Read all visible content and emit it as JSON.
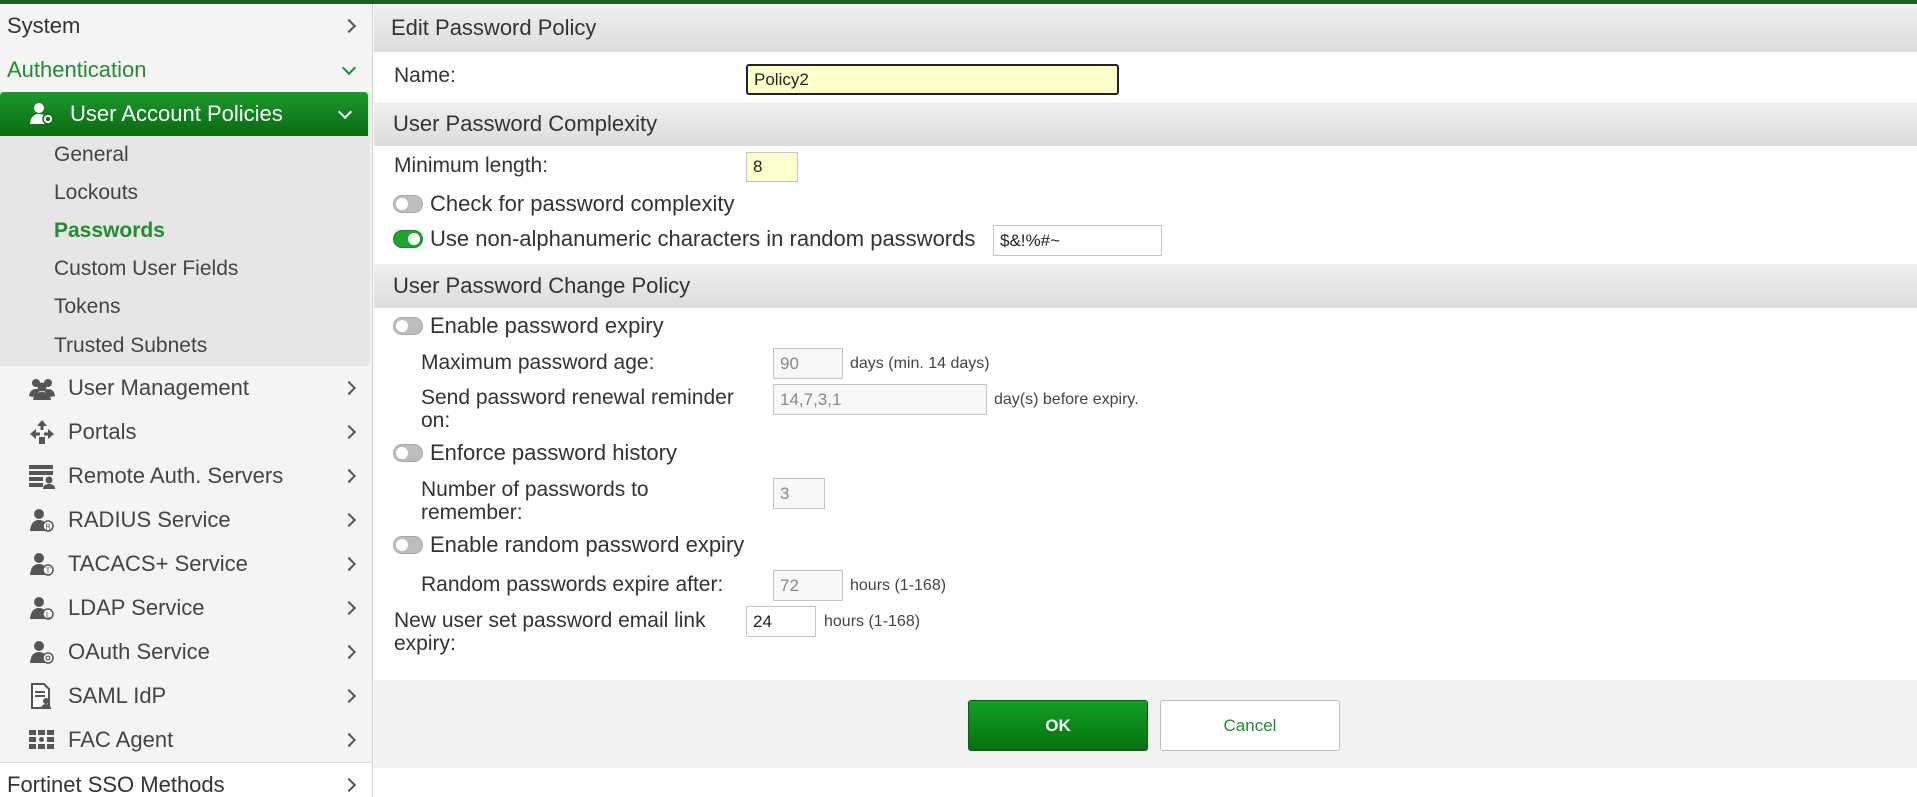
{
  "sidebar": {
    "system": "System",
    "authentication": "Authentication",
    "section": "User Account Policies",
    "sub_items": [
      "General",
      "Lockouts",
      "Passwords",
      "Custom User Fields",
      "Tokens",
      "Trusted Subnets"
    ],
    "selected_sub": "Passwords",
    "items": [
      {
        "label": "User Management",
        "icon": "users-icon"
      },
      {
        "label": "Portals",
        "icon": "portals-icon"
      },
      {
        "label": "Remote Auth. Servers",
        "icon": "servers-icon"
      },
      {
        "label": "RADIUS Service",
        "icon": "radius-icon"
      },
      {
        "label": "TACACS+ Service",
        "icon": "tacacs-icon"
      },
      {
        "label": "LDAP Service",
        "icon": "ldap-icon"
      },
      {
        "label": "OAuth Service",
        "icon": "oauth-icon"
      },
      {
        "label": "SAML IdP",
        "icon": "saml-icon"
      },
      {
        "label": "FAC Agent",
        "icon": "fac-agent-icon"
      }
    ],
    "fortinet_sso": "Fortinet SSO Methods"
  },
  "main": {
    "title": "Edit Password Policy",
    "name_label": "Name:",
    "name_value": "Policy2",
    "complexity": {
      "header": "User Password Complexity",
      "min_length_label": "Minimum length:",
      "min_length_value": "8",
      "check_complexity_label": "Check for password complexity",
      "check_complexity_on": false,
      "non_alnum_label": "Use non-alphanumeric characters in random passwords",
      "non_alnum_on": true,
      "non_alnum_value": "$&!%#~"
    },
    "change_policy": {
      "header": "User Password Change Policy",
      "expiry_label": "Enable password expiry",
      "expiry_on": false,
      "max_age_label": "Maximum password age:",
      "max_age_value": "90",
      "max_age_hint": "days (min. 14 days)",
      "reminder_label_1": "Send password renewal reminder",
      "reminder_label_2": "on:",
      "reminder_value": "14,7,3,1",
      "reminder_hint": "day(s) before expiry.",
      "history_label": "Enforce password history",
      "history_on": false,
      "remember_label_1": "Number of passwords to",
      "remember_label_2": "remember:",
      "remember_value": "3",
      "random_expiry_label": "Enable random password expiry",
      "random_expiry_on": false,
      "random_after_label": "Random passwords expire after:",
      "random_after_value": "72",
      "random_after_hint": "hours (1-168)",
      "email_link_label_1": "New user set password email link",
      "email_link_label_2": "expiry:",
      "email_link_value": "24",
      "email_link_hint": "hours (1-168)"
    },
    "ok": "OK",
    "cancel": "Cancel"
  },
  "colors": {
    "accent": "#1e8e2e",
    "topbar": "#1b5e20",
    "input_highlight": "#ffffcc"
  }
}
